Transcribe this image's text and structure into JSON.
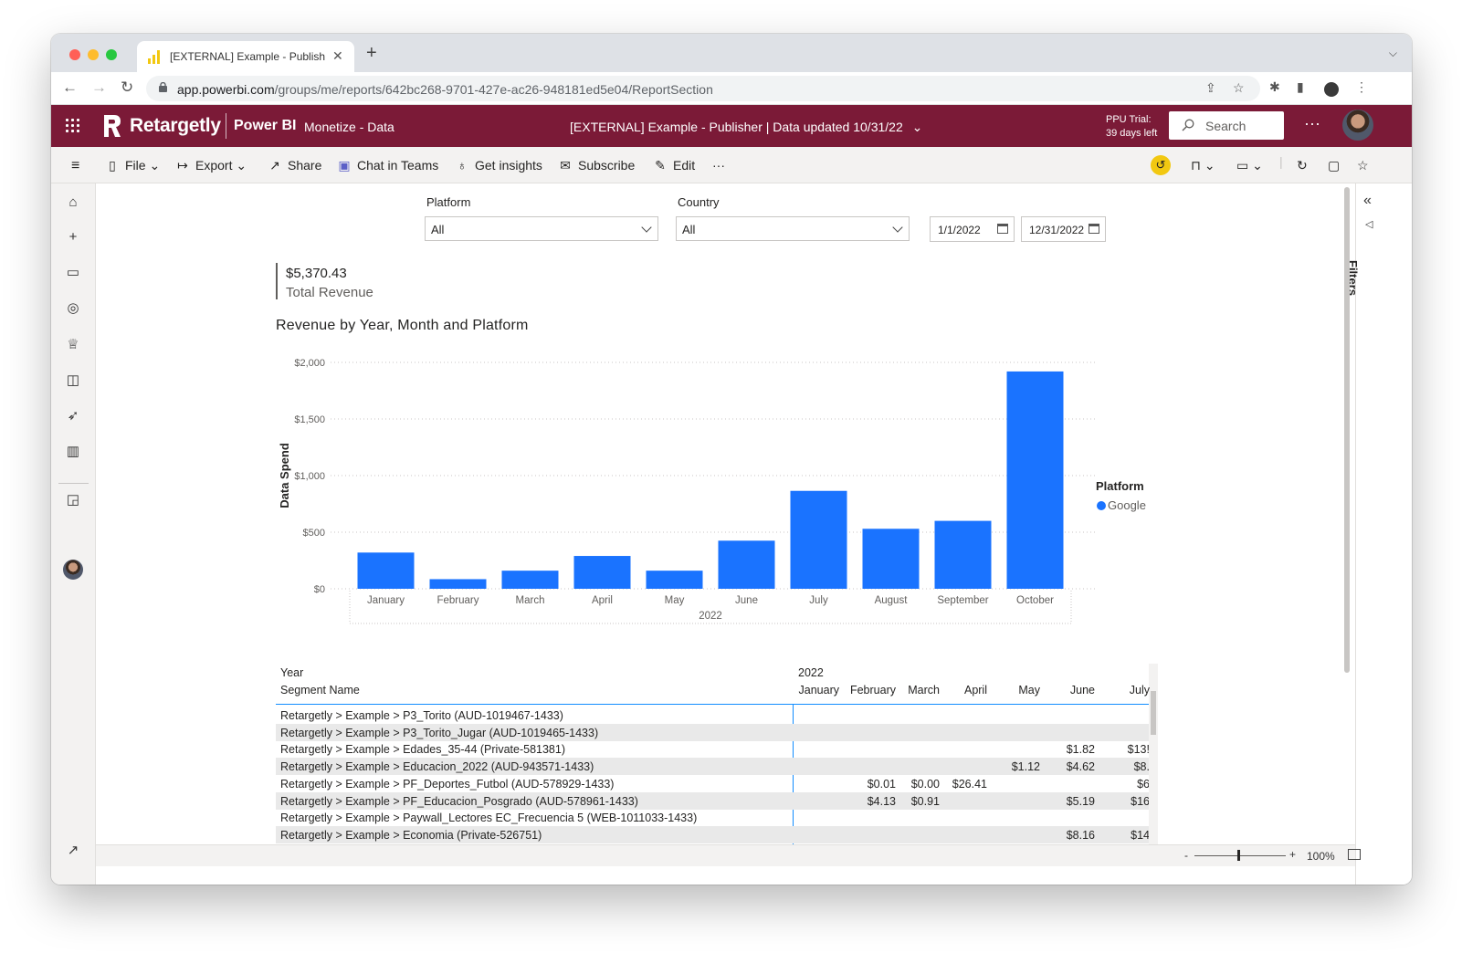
{
  "browser": {
    "tab_title": "[EXTERNAL] Example - Publish",
    "url_host": "app.powerbi.com",
    "url_path": "/groups/me/reports/642bc268-9701-427e-ac26-948181ed5e04/ReportSection"
  },
  "header": {
    "brand": "Retargetly",
    "product": "Power BI",
    "workspace": "Monetize - Data",
    "report_title": "[EXTERNAL] Example - Publisher  |   Data updated 10/31/22",
    "ppu_line1": "PPU Trial:",
    "ppu_line2": "39 days left",
    "search_placeholder": "Search",
    "brand_color": "#7b1a37"
  },
  "commands": {
    "file": "File",
    "export": "Export",
    "share": "Share",
    "chat": "Chat in Teams",
    "insights": "Get insights",
    "subscribe": "Subscribe",
    "edit": "Edit"
  },
  "filters_pane": {
    "label": "Filters"
  },
  "slicers": {
    "platform_title": "Platform",
    "platform_value": "All",
    "country_title": "Country",
    "country_value": "All",
    "date_start": "1/1/2022",
    "date_end": "12/31/2022"
  },
  "kpi": {
    "value": "$5,370.43",
    "label": "Total Revenue"
  },
  "chart_title": "Revenue by Year, Month and Platform",
  "chart_data": {
    "type": "bar",
    "title": "Revenue by Year, Month and Platform",
    "ylabel": "Data Spend",
    "xlabel": "2022",
    "categories": [
      "January",
      "February",
      "March",
      "April",
      "May",
      "June",
      "July",
      "August",
      "September",
      "October"
    ],
    "series": [
      {
        "name": "Google",
        "values": [
          320,
          85,
          160,
          290,
          160,
          425,
          865,
          530,
          600,
          1920
        ],
        "color": "#1a73ff"
      }
    ],
    "ylim": [
      0,
      2000
    ],
    "yticks": [
      0,
      500,
      1000,
      1500,
      2000
    ],
    "ytick_labels": [
      "$0",
      "$500",
      "$1,000",
      "$1,500",
      "$2,000"
    ],
    "legend_title": "Platform",
    "legend_position": "right",
    "grid": true
  },
  "matrix": {
    "row_header_1": "Year",
    "row_header_2": "Segment Name",
    "year": "2022",
    "months": [
      "January",
      "February",
      "March",
      "April",
      "May",
      "June",
      "July"
    ],
    "rows": [
      {
        "segment": "Retargetly > Example > P3_Torito (AUD-1019467-1433)",
        "values": [
          "",
          "",
          "",
          "",
          "",
          "",
          ""
        ]
      },
      {
        "segment": "Retargetly > Example > P3_Torito_Jugar (AUD-1019465-1433)",
        "values": [
          "",
          "",
          "",
          "",
          "",
          "",
          ""
        ]
      },
      {
        "segment": "Retargetly > Example > Edades_35-44 (Private-581381)",
        "values": [
          "",
          "",
          "",
          "",
          "",
          "$1.82",
          "$13!"
        ]
      },
      {
        "segment": "Retargetly > Example > Educacion_2022 (AUD-943571-1433)",
        "values": [
          "",
          "",
          "",
          "",
          "$1.12",
          "$4.62",
          "$8."
        ]
      },
      {
        "segment": "Retargetly > Example > PF_Deportes_Futbol (AUD-578929-1433)",
        "values": [
          "",
          "$0.01",
          "$0.00",
          "$26.41",
          "",
          "",
          "$6"
        ]
      },
      {
        "segment": "Retargetly > Example > PF_Educacion_Posgrado (AUD-578961-1433)",
        "values": [
          "",
          "$4.13",
          "$0.91",
          "",
          "",
          "$5.19",
          "$16"
        ]
      },
      {
        "segment": "Retargetly > Example > Paywall_Lectores EC_Frecuencia 5 (WEB-1011033-1433)",
        "values": [
          "",
          "",
          "",
          "",
          "",
          "",
          ""
        ]
      },
      {
        "segment": "Retargetly > Example > Economia (Private-526751)",
        "values": [
          "",
          "",
          "",
          "",
          "",
          "$8.16",
          "$14"
        ]
      }
    ]
  },
  "status": {
    "zoom_minus": "-",
    "zoom_plus": "+",
    "zoom": "100%"
  }
}
